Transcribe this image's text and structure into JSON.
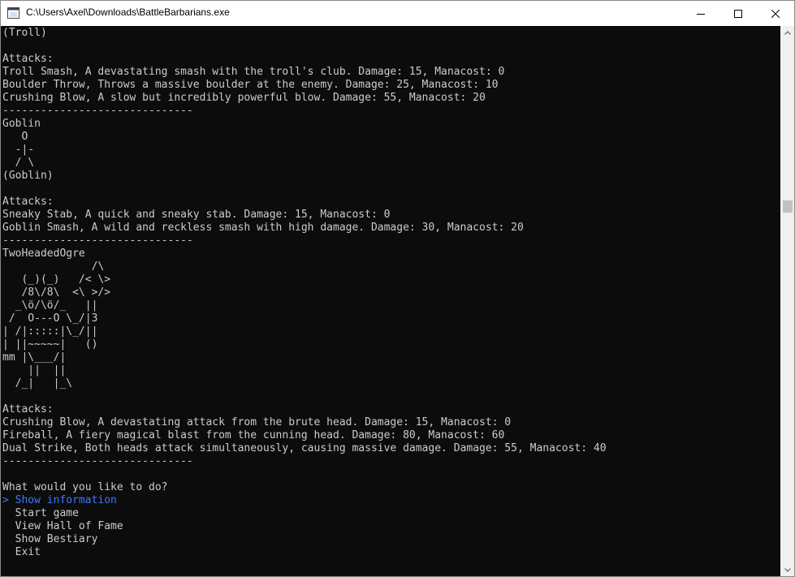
{
  "window": {
    "title": "C:\\Users\\Axel\\Downloads\\BattleBarbarians.exe",
    "icon": "console-app-icon",
    "controls": [
      "minimize-icon",
      "maximize-icon",
      "close-icon"
    ]
  },
  "console": {
    "output": "(Troll)\n\nAttacks:\nTroll Smash, A devastating smash with the troll's club. Damage: 15, Manacost: 0\nBoulder Throw, Throws a massive boulder at the enemy. Damage: 25, Manacost: 10\nCrushing Blow, A slow but incredibly powerful blow. Damage: 55, Manacost: 20\n------------------------------\nGoblin\n   O\n  -|-\n  / \\\n(Goblin)\n\nAttacks:\nSneaky Stab, A quick and sneaky stab. Damage: 15, Manacost: 0\nGoblin Smash, A wild and reckless smash with high damage. Damage: 30, Manacost: 20\n------------------------------\nTwoHeadedOgre\n              /\\\n   (_)(_)   /< \\>\n   /8\\/8\\  <\\ >/>\n  _\\ö/\\ö/_   ||\n /  O---O \\_/|3\n| /|:::::|\\_/||\n| ||~~~~~|   ()\nmm |\\___/|\n    ||  ||\n  /_|   |_\\\n\nAttacks:\nCrushing Blow, A devastating attack from the brute head. Damage: 15, Manacost: 0\nFireball, A fiery magical blast from the cunning head. Damage: 80, Manacost: 60\nDual Strike, Both heads attack simultaneously, causing massive damage. Damage: 55, Manacost: 40\n------------------------------\n\nWhat would you like to do?\n",
    "menu": [
      {
        "text": "> Show information",
        "selected": true
      },
      {
        "text": "  Start game",
        "selected": false
      },
      {
        "text": "  View Hall of Fame",
        "selected": false
      },
      {
        "text": "  Show Bestiary",
        "selected": false
      },
      {
        "text": "  Exit",
        "selected": false
      }
    ],
    "colors": {
      "background": "#0c0c0c",
      "text": "#cccccc",
      "selected": "#3b78ff"
    }
  },
  "scrollbar": {
    "up_icon": "scroll-up-arrow-icon",
    "down_icon": "scroll-down-arrow-icon"
  }
}
